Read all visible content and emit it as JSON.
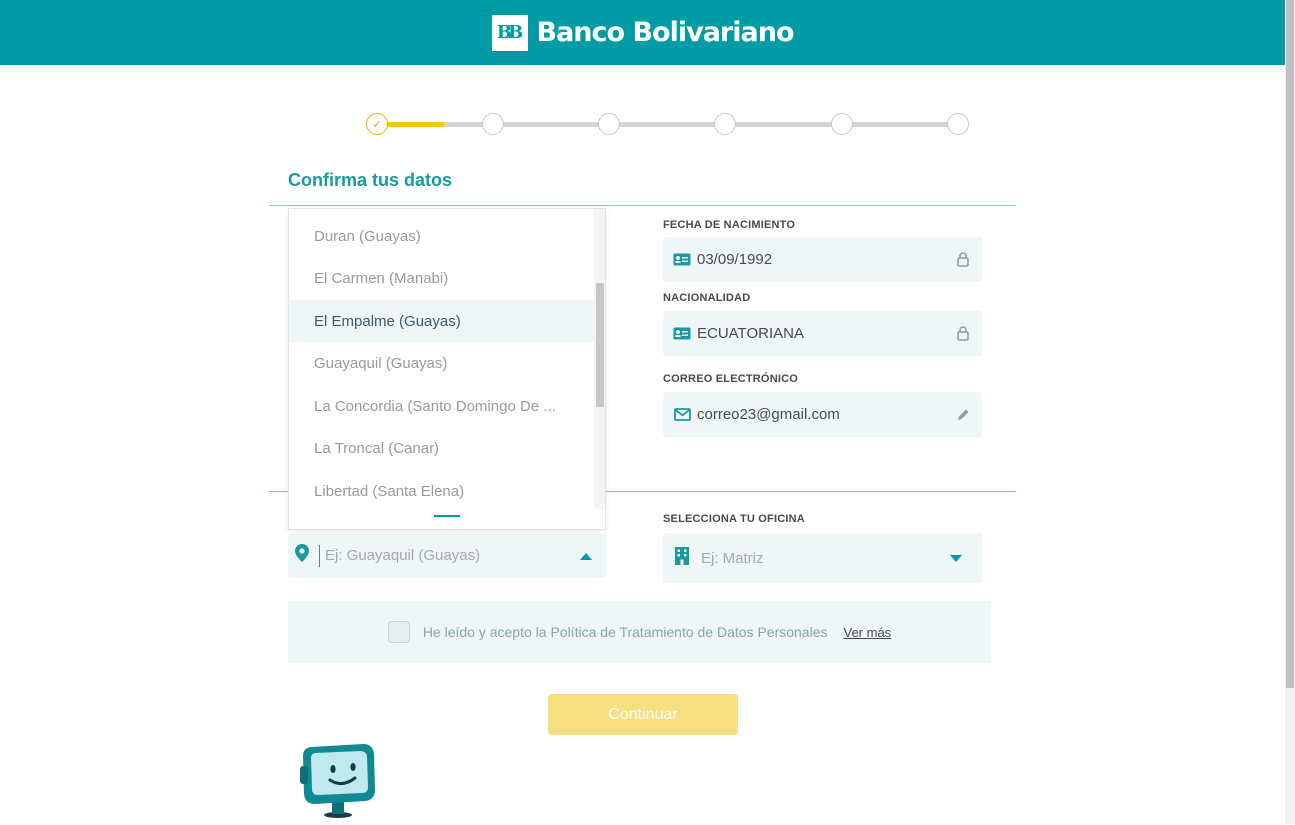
{
  "header": {
    "logo_mark": "BB",
    "brand_name": "Banco Bolivariano",
    "brand_color": "#009ca6"
  },
  "stepper": {
    "total_steps": 6,
    "current_step": 1,
    "progress_into_next": 0.5,
    "completed_glyph": "✓"
  },
  "section": {
    "title": "Confirma tus datos"
  },
  "fields": {
    "birth_date": {
      "label": "FECHA DE NACIMIENTO",
      "value": "03/09/1992",
      "icon": "id-card-icon",
      "trail_icon": "lock-icon"
    },
    "nationality": {
      "label": "NACIONALIDAD",
      "value": "ECUATORIANA",
      "icon": "id-card-icon",
      "trail_icon": "lock-icon"
    },
    "email": {
      "label": "CORREO ELECTRÓNICO",
      "value": "correo23@gmail.com",
      "icon": "mail-icon",
      "trail_icon": "pencil-icon"
    }
  },
  "city_dropdown": {
    "options": [
      "Duran (Guayas)",
      "El Carmen (Manabi)",
      "El Empalme (Guayas)",
      "Guayaquil (Guayas)",
      "La Concordia (Santo Domingo De ...",
      "La Troncal (Canar)",
      "Libertad (Santa Elena)"
    ],
    "highlighted": "El Empalme (Guayas)",
    "placeholder": "Ej: Guayaquil (Guayas)",
    "icon": "map-pin-icon",
    "toggle_icon": "caret-up-icon"
  },
  "office": {
    "label": "SELECCIONA TU OFICINA",
    "placeholder": "Ej: Matriz",
    "icon": "building-icon",
    "toggle_icon": "caret-down-icon"
  },
  "consent": {
    "text": "He leído y acepto la Política de Tratamiento de Datos Personales",
    "link": "Ver más",
    "checked": false
  },
  "actions": {
    "continue_label": "Continuar",
    "continue_color": "#f5df80"
  },
  "mascot": {
    "icon": "robot-mascot-icon"
  }
}
